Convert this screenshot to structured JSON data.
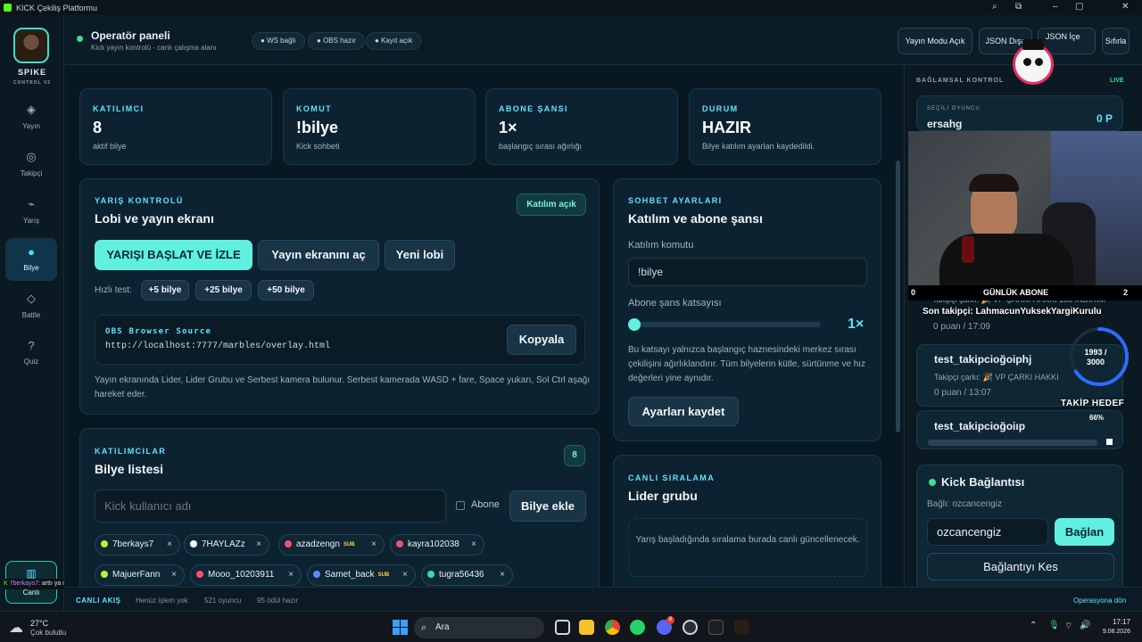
{
  "window": {
    "title": "KICK Çekiliş Platformu"
  },
  "brand": {
    "name": "SPIKE",
    "tagline": "CONTROL V2"
  },
  "nav": [
    {
      "label": "Yayın",
      "icon": "diamond-icon"
    },
    {
      "label": "Takipçi",
      "icon": "target-icon"
    },
    {
      "label": "Yarış",
      "icon": "dash-icon"
    },
    {
      "label": "Bilye",
      "icon": "dot-icon"
    },
    {
      "label": "Battle",
      "icon": "diamond-outline-icon"
    },
    {
      "label": "Quiz",
      "icon": "question-icon"
    }
  ],
  "live_button": {
    "label": "Canlı",
    "icon": "columns-icon"
  },
  "header": {
    "title": "Operatör paneli",
    "subtitle": "Kick yayın kontrolü · canlı çalışma alanı",
    "pills": [
      "WS bağlı",
      "OBS hazır",
      "Kayıt açık"
    ],
    "buttons": {
      "stream_mode": "Yayın Modu Açık",
      "json_export": "JSON Dışa",
      "json_import": "JSON İçe",
      "reset": "Sıfırla"
    }
  },
  "stats": [
    {
      "label": "KATILIMCI",
      "value": "8",
      "sub": "aktif bilye"
    },
    {
      "label": "KOMUT",
      "value": "!bilye",
      "sub": "Kick sohbeti"
    },
    {
      "label": "ABONE ŞANSI",
      "value": "1×",
      "sub": "başlangıç sırası ağırlığı"
    },
    {
      "label": "DURUM",
      "value": "HAZIR",
      "sub": "Bilye katılım ayarları kaydedildi."
    }
  ],
  "race": {
    "kicker": "YARIŞ KONTROLÜ",
    "title": "Lobi ve yayın ekranı",
    "badge": "Katılım açık",
    "start": "YARIŞI BAŞLAT VE İZLE",
    "open_screen": "Yayın ekranını aç",
    "new_lobby": "Yeni lobi",
    "quick_label": "Hızlı test:",
    "quick": [
      "+5 bilye",
      "+25 bilye",
      "+50 bilye"
    ],
    "obs_label": "OBS Browser Source",
    "obs_url": "http://localhost:7777/marbles/overlay.html",
    "copy": "Kopyala",
    "note": "Yayın ekranında Lider, Lider Grubu ve Serbest kamera bulunur. Serbest kamerada WASD + fare, Space yukarı, Sol Ctrl aşağı hareket eder."
  },
  "chat_settings": {
    "kicker": "SOHBET AYARLARI",
    "title": "Katılım ve abone şansı",
    "cmd_label": "Katılım komutu",
    "cmd_value": "!bilye",
    "sub_label": "Abone şans katsayısı",
    "sub_value": "1×",
    "slider_fraction": 0,
    "desc": "Bu katsayı yalnızca başlangıç haznesindeki merkez sırası çekilişini ağırlıklandırır. Tüm bilyelerin kütle, sürtünme ve hız değerleri yine aynıdır.",
    "save": "Ayarları kaydet"
  },
  "participants": {
    "kicker": "KATILIMCILAR",
    "title": "Bilye listesi",
    "count": "8",
    "input_placeholder": "Kick kullanıcı adı",
    "sub_checkbox": "Abone",
    "add": "Bilye ekle",
    "chips": [
      {
        "name": "7berkays7",
        "color": "#b8f03c",
        "sub": ""
      },
      {
        "name": "7HAYLAZz",
        "color": "#ffffff",
        "sub": ""
      },
      {
        "name": "azadzengn",
        "color": "#ff4d6d",
        "sub": "SUB"
      },
      {
        "name": "kayra102038",
        "color": "#ff4d6d",
        "sub": ""
      },
      {
        "name": "MajuerFann",
        "color": "#b8f03c",
        "sub": ""
      },
      {
        "name": "Mooo_10203911",
        "color": "#ff4d6d",
        "sub": ""
      },
      {
        "name": "Samet_back",
        "color": "#5b8cff",
        "sub": "SUB"
      },
      {
        "name": "tugra56436",
        "color": "#2fe0b0",
        "sub": ""
      }
    ]
  },
  "ranking": {
    "kicker": "CANLI SIRALAMA",
    "title": "Lider grubu",
    "empty": "Yarış başladığında sıralama burada canlı güncellenecek."
  },
  "status": {
    "live": "CANLI AKIŞ",
    "items": [
      "Henüz işlem yok",
      "521 oyuncu",
      "95 ödül hazır"
    ],
    "right": "Operasyona dön"
  },
  "right_panel": {
    "title": "BAĞLAMSAL KONTROL",
    "live": "LIVE",
    "selected_label": "SEÇİLİ OYUNCU",
    "selected_name": "ersahg",
    "selected_points": "0 P",
    "entries": [
      {
        "name": "test_takipcioğoiphj",
        "detail": "Takipçi çarkı: 🎉 VP ÇARKI HAKKI",
        "meta": "0 puan / 13:07"
      },
      {
        "name": "test_takipcioğoiıp",
        "detail": "",
        "meta": ""
      }
    ],
    "partial_top": "Takipçi çarkı: 🎉 VP ÇARKI HAKKI 150 İNDİRİM",
    "partial_meta": "0 puan / 17:09",
    "kick": {
      "title": "Kick Bağlantısı",
      "connected": "Bağlı: ozcancengiz",
      "input": "ozcancengiz",
      "connect": "Bağlan",
      "disconnect": "Bağlantıyı Kes"
    }
  },
  "overlay": {
    "daily_sub_label": "GÜNLÜK ABONE",
    "daily_left": "0",
    "daily_right": "2",
    "last_follower": "Son takipçi: LahmacunYuksekYargiKurulu",
    "goal_value": "1993 / 3000",
    "goal_label": "TAKİP HEDEF",
    "goal_fraction": 0.66,
    "goal_pct": "66%"
  },
  "toast": {
    "user": "7berkays7",
    "text": ": arttı ya monitörlerde"
  },
  "taskbar": {
    "temp": "27°C",
    "weather": "Çok bulutlu",
    "search": "Ara",
    "time": "17:17",
    "date": "9.08.2026",
    "badge": "8"
  }
}
